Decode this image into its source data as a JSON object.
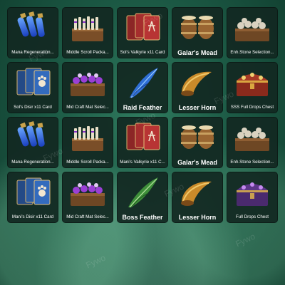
{
  "watermark_text": "Fywo",
  "items": [
    {
      "label": "Mana Regeneration...",
      "icon": "mana-potion-icon",
      "big": false
    },
    {
      "label": "Middle Scroll Packa...",
      "icon": "scroll-crate-icon",
      "big": false
    },
    {
      "label": "Sol's Valkyrie x11 Card",
      "icon": "red-card-icon",
      "big": false
    },
    {
      "label": "Galar's Mead",
      "icon": "mead-barrel-icon",
      "big": true
    },
    {
      "label": "Enh.Stone Selection...",
      "icon": "stone-crate-icon",
      "big": false
    },
    {
      "label": "Sol's Disir x11 Card",
      "icon": "blue-card-icon",
      "big": false
    },
    {
      "label": "Mid Craft Mat Selec...",
      "icon": "purple-crate-icon",
      "big": false
    },
    {
      "label": "Raid Feather",
      "icon": "blue-feather-icon",
      "big": true
    },
    {
      "label": "Lesser Horn",
      "icon": "horn-icon",
      "big": true
    },
    {
      "label": "SSS Full Drops Chest",
      "icon": "treasure-chest-icon",
      "big": false
    },
    {
      "label": "Mana Regeneration...",
      "icon": "mana-potion-icon",
      "big": false
    },
    {
      "label": "Middle Scroll Packa...",
      "icon": "scroll-crate-icon",
      "big": false
    },
    {
      "label": "Mani's Valkyrie x11 C...",
      "icon": "red-card-icon",
      "big": false
    },
    {
      "label": "Galar's Mead",
      "icon": "mead-barrel-icon",
      "big": true
    },
    {
      "label": "Enh.Stone Selection...",
      "icon": "stone-crate-icon",
      "big": false
    },
    {
      "label": "Mani's Disir x11 Card",
      "icon": "blue-card-icon",
      "big": false
    },
    {
      "label": "Mid Craft Mat Selec...",
      "icon": "purple-crate-icon",
      "big": false
    },
    {
      "label": "Boss Feather",
      "icon": "green-feather-icon",
      "big": true
    },
    {
      "label": "Lesser Horn",
      "icon": "horn-icon",
      "big": true
    },
    {
      "label": "Full Drops Chest",
      "icon": "purple-chest-icon",
      "big": false
    }
  ]
}
